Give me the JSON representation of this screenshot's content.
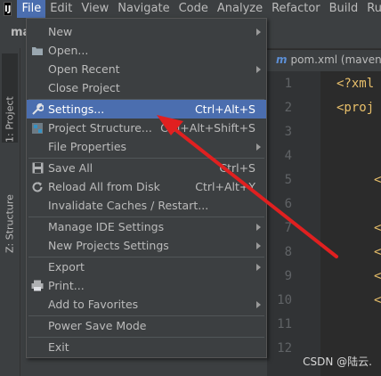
{
  "menubar": {
    "items": [
      {
        "label": "File",
        "underline": "F",
        "active": true
      },
      {
        "label": "Edit",
        "underline": "E"
      },
      {
        "label": "View",
        "underline": "V"
      },
      {
        "label": "Navigate",
        "underline": "N"
      },
      {
        "label": "Code",
        "underline": "C"
      },
      {
        "label": "Analyze",
        "underline": "z"
      },
      {
        "label": "Refactor",
        "underline": "R"
      },
      {
        "label": "Build",
        "underline": "B"
      },
      {
        "label": "Run",
        "underline": "u"
      }
    ]
  },
  "navbar": {
    "text": "ma"
  },
  "leftstrip": {
    "project_tab": "1: Project",
    "structure_tab": "Z: Structure"
  },
  "editor": {
    "tab_label": "pom.xml (maven",
    "line_numbers": [
      "1",
      "2",
      "3",
      "4",
      "5",
      "6",
      "7",
      "8",
      "9",
      "10",
      "11",
      "12"
    ],
    "code": {
      "line1": "<?xml",
      "line2": "<proj",
      "line5": "<",
      "line7": "<",
      "line8": "<",
      "line9": "<",
      "line10": "<"
    }
  },
  "file_menu": {
    "new": "New",
    "open": "Open...",
    "open_recent": "Open Recent",
    "close_project": "Close Project",
    "settings": "Settings...",
    "settings_shortcut": "Ctrl+Alt+S",
    "project_structure": "Project Structure...",
    "project_structure_shortcut": "Ctrl+Alt+Shift+S",
    "file_properties": "File Properties",
    "save_all": "Save All",
    "save_all_shortcut": "Ctrl+S",
    "reload": "Reload All from Disk",
    "reload_shortcut": "Ctrl+Alt+Y",
    "invalidate": "Invalidate Caches / Restart...",
    "manage_ide": "Manage IDE Settings",
    "new_projects_settings": "New Projects Settings",
    "export": "Export",
    "print": "Print...",
    "add_to_favorites": "Add to Favorites",
    "power_save": "Power Save Mode",
    "exit": "Exit"
  },
  "watermark": "CSDN @陆云.",
  "colors": {
    "selection": "#4b6eaf",
    "annotation_arrow": "#e02020",
    "menu_bg": "#3c3f41"
  }
}
